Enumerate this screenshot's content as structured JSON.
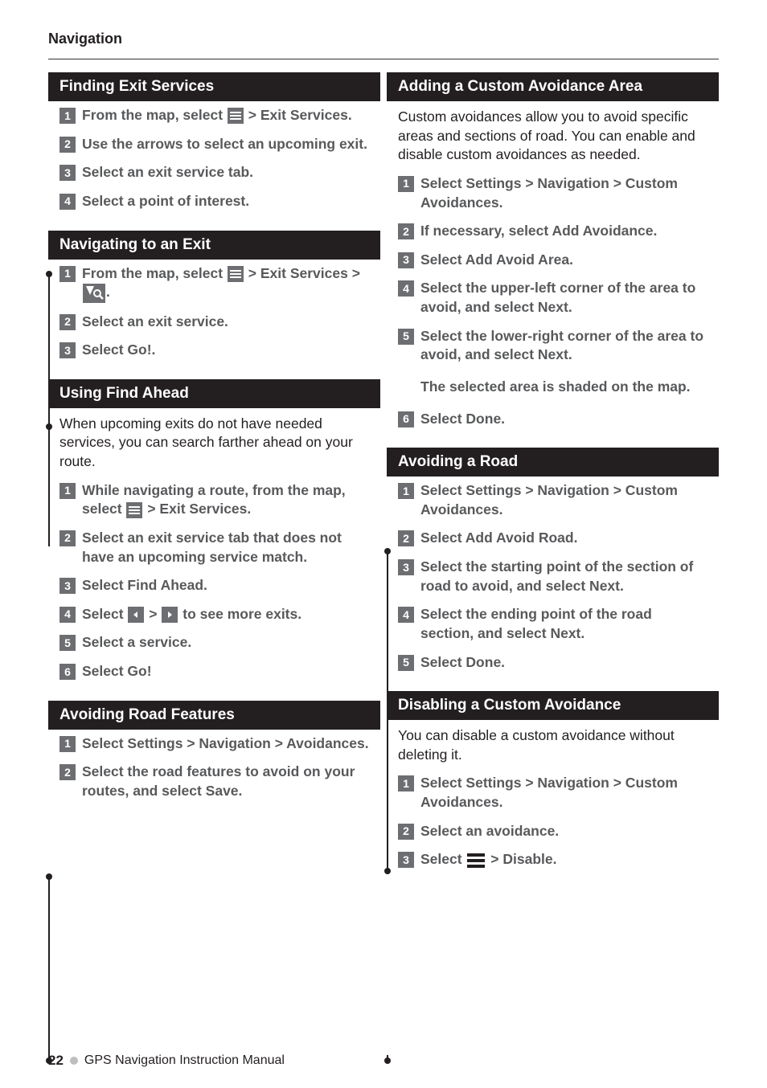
{
  "section": "Navigation",
  "left": {
    "card1": {
      "title": "Finding Exit Services",
      "steps": [
        {
          "pre": "From the map, select ",
          "icon": "menu",
          "post": " > Exit Services."
        },
        {
          "text": "Use the arrows to select an upcoming exit."
        },
        {
          "text": "Select an exit service tab."
        },
        {
          "text": "Select a point of interest."
        }
      ]
    },
    "card2": {
      "title": "Navigating to an Exit",
      "steps": [
        {
          "pre": "From the map, select ",
          "icon": "menu",
          "mid": " > Exit Services > ",
          "icon2": "poi",
          "post": "."
        },
        {
          "text": "Select an exit service."
        },
        {
          "text": "Select Go!."
        }
      ]
    },
    "card3": {
      "title": "Using Find Ahead",
      "intro": "When upcoming exits do not have needed services, you can search farther ahead on your route.",
      "steps": [
        {
          "pre": "While navigating a route, from the map, select ",
          "icon": "menu",
          "post": " > Exit Services."
        },
        {
          "text": "Select an exit service tab that does not have an upcoming service match."
        },
        {
          "text": "Select Find Ahead."
        },
        {
          "pre": "Select  ",
          "icon": "left",
          "mid": " > ",
          "icon2": "right",
          "post": " to see more exits."
        },
        {
          "text": "Select a service."
        },
        {
          "text": "Select Go!"
        }
      ]
    },
    "card4": {
      "title": "Avoiding Road Features",
      "steps": [
        {
          "text": "Select Settings > Navigation > Avoidances."
        },
        {
          "text": "Select the road features to avoid on your routes, and select Save."
        }
      ]
    }
  },
  "right": {
    "card1": {
      "title": "Adding a Custom Avoidance Area",
      "intro": "Custom avoidances allow you to avoid specific areas and sections of road. You can enable and disable custom avoidances as needed.",
      "steps": [
        {
          "text": "Select Settings > Navigation > Custom Avoidances."
        },
        {
          "text": "If necessary, select Add Avoidance."
        },
        {
          "text": "Select Add Avoid Area."
        },
        {
          "text": "Select the upper-left corner of the area to avoid, and select Next."
        },
        {
          "text": "Select the lower-right corner of the area to avoid, and select Next."
        }
      ],
      "result": "The selected area is shaded on the map.",
      "steps2": [
        {
          "text": "Select Done."
        }
      ]
    },
    "card2": {
      "title": "Avoiding a Road",
      "steps": [
        {
          "text": "Select Settings > Navigation > Custom Avoidances."
        },
        {
          "text": "Select Add Avoid Road."
        },
        {
          "text": "Select the starting point of the section of road to avoid, and select Next."
        },
        {
          "text": "Select the ending point of the road section, and select Next."
        },
        {
          "text": "Select Done."
        }
      ]
    },
    "card3": {
      "title": "Disabling a Custom Avoidance",
      "intro": "You can disable a custom avoidance without deleting it.",
      "steps": [
        {
          "text": "Select Settings > Navigation > Custom Avoidances."
        },
        {
          "text": "Select an avoidance."
        },
        {
          "pre": "Select ",
          "icon": "menu-bw",
          "post": " > Disable."
        }
      ]
    }
  },
  "footer": {
    "page": "22",
    "title": "GPS Navigation Instruction Manual"
  }
}
